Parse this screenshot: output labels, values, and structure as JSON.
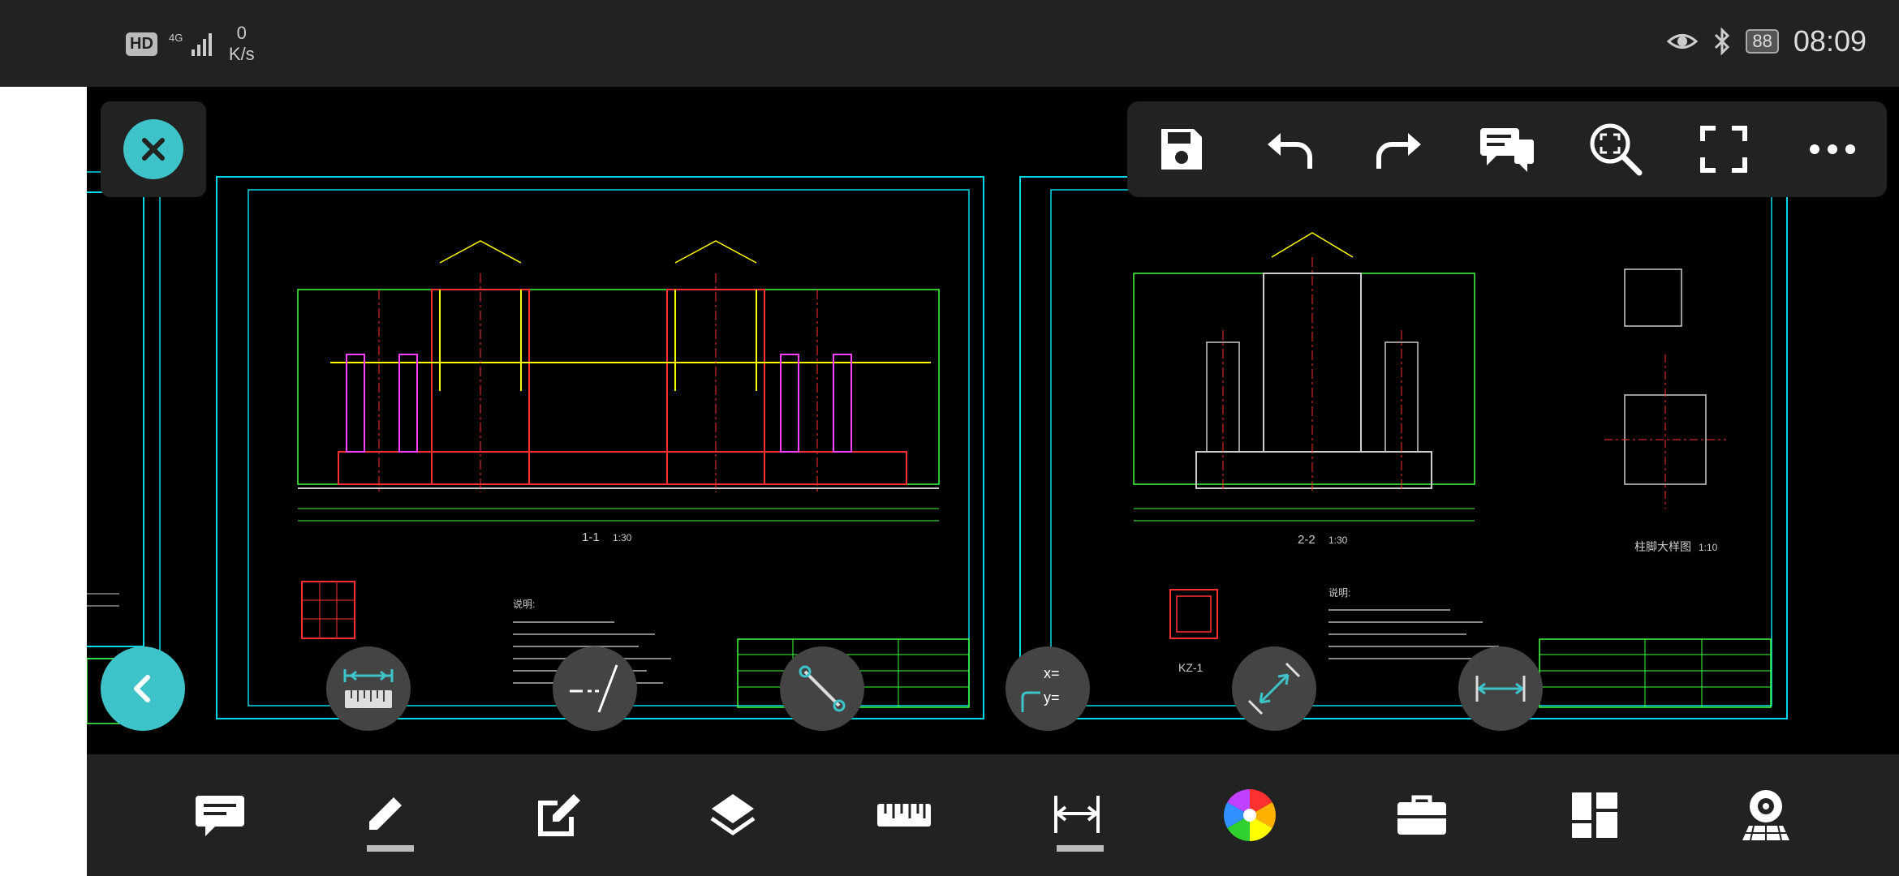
{
  "status_bar": {
    "hd": "HD",
    "network": "4G",
    "speed_value": "0",
    "speed_unit": "K/s",
    "battery": "88",
    "time": "08:09"
  },
  "drawing": {
    "sheet1": {
      "section_label": "1-1",
      "section_scale": "1:30",
      "notes_title": "说明:"
    },
    "sheet2": {
      "section_label": "2-2",
      "section_scale": "1:30",
      "detail_label": "柱脚大样图",
      "detail_scale": "1:10",
      "column_label": "KZ-1",
      "notes_title": "说明:"
    }
  },
  "top_toolbar": {
    "icons": [
      "save-icon",
      "undo-icon",
      "redo-icon",
      "comment-icon",
      "zoom-extents-icon",
      "fullscreen-icon",
      "more-icon"
    ]
  },
  "float_tools": [
    "ruler-icon",
    "extend-line-icon",
    "line-tool-icon",
    "coordinate-icon",
    "aligned-dimension-icon",
    "linear-dimension-icon"
  ],
  "bottom_bar": {
    "icons": [
      "annotation-icon",
      "pencil-icon",
      "edit-icon",
      "layers-icon",
      "measure-icon",
      "dimension-icon",
      "color-wheel-icon",
      "toolbox-icon",
      "dashboard-icon",
      "view-3d-icon"
    ]
  },
  "colors": {
    "accent": "#3ec4c8",
    "panel": "#222222",
    "drawing_cyan": "#00e5ff",
    "drawing_yellow": "#ffff00",
    "drawing_red": "#ff2020",
    "drawing_magenta": "#ff40ff",
    "drawing_green": "#40ff40"
  }
}
